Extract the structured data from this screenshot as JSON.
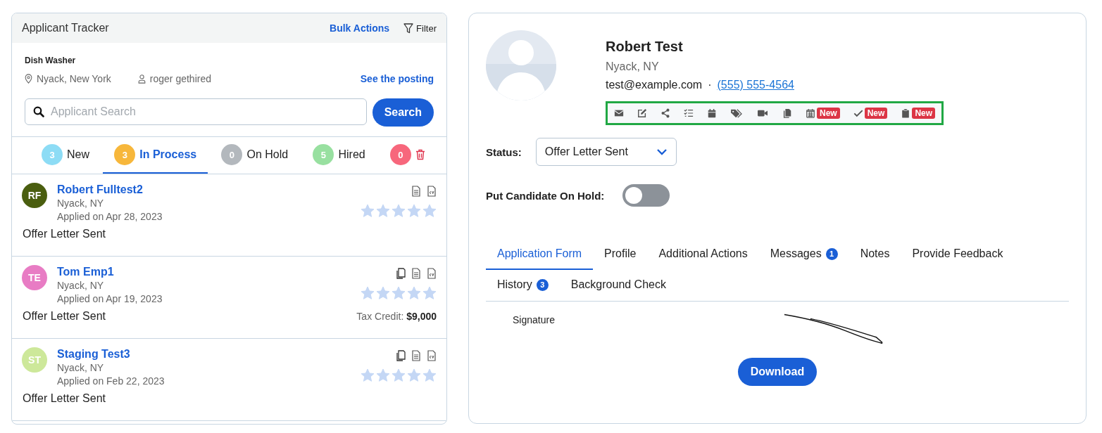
{
  "tracker": {
    "title": "Applicant Tracker",
    "bulk_actions": "Bulk Actions",
    "filter": "Filter",
    "job": {
      "title": "Dish Washer",
      "location": "Nyack, New York",
      "recruiter": "roger gethired",
      "posting_link": "See the posting"
    },
    "search": {
      "placeholder": "Applicant Search",
      "button": "Search"
    },
    "stages": [
      {
        "kind": "stage",
        "count": "3",
        "label": "New",
        "color": "#8ddcf5",
        "selected": false
      },
      {
        "kind": "stage",
        "count": "3",
        "label": "In Process",
        "color": "#f7b73b",
        "selected": true
      },
      {
        "kind": "stage",
        "count": "0",
        "label": "On Hold",
        "color": "#b3b8bd",
        "selected": false
      },
      {
        "kind": "stage",
        "count": "5",
        "label": "Hired",
        "color": "#98e0a0",
        "selected": false
      },
      {
        "kind": "trash",
        "count": "0",
        "color": "#f7677c",
        "selected": false
      }
    ],
    "applicants": [
      {
        "initials": "RF",
        "color": "#4a5e0f",
        "name": "Robert Fulltest2",
        "location": "Nyack, NY",
        "applied": "Applied on Apr 28, 2023",
        "status": "Offer Letter Sent",
        "files": [
          {
            "kind": "document"
          },
          {
            "kind": "cv"
          }
        ],
        "stars": 5
      },
      {
        "initials": "TE",
        "color": "#e87cc4",
        "name": "Tom Emp1",
        "location": "Nyack, NY",
        "applied": "Applied on Apr 19, 2023",
        "status": "Offer Letter Sent",
        "files": [
          {
            "kind": "copy"
          },
          {
            "kind": "document"
          },
          {
            "kind": "cv"
          }
        ],
        "stars": 5,
        "tax_credit_label": "Tax Credit:",
        "tax_credit": "$9,000"
      },
      {
        "initials": "ST",
        "color": "#cde89a",
        "name": "Staging Test3",
        "location": "Nyack, NY",
        "applied": "Applied on Feb 22, 2023",
        "status": "Offer Letter Sent",
        "files": [
          {
            "kind": "copy"
          },
          {
            "kind": "document"
          },
          {
            "kind": "cv"
          }
        ],
        "stars": 5
      }
    ]
  },
  "candidate": {
    "name": "Robert Test",
    "location": "Nyack, NY",
    "email": "test@example.com",
    "separator": "·",
    "phone": "(555) 555-4564",
    "actions": [
      {
        "kind": "mail"
      },
      {
        "kind": "edit"
      },
      {
        "kind": "share"
      },
      {
        "kind": "checklist"
      },
      {
        "kind": "calendar"
      },
      {
        "kind": "tags"
      },
      {
        "kind": "video"
      },
      {
        "kind": "copy"
      },
      {
        "kind": "grid-calendar",
        "badge": "New"
      },
      {
        "kind": "check",
        "badge": "New"
      },
      {
        "kind": "clipboard",
        "badge": "New"
      }
    ],
    "status_label": "Status:",
    "status_value": "Offer Letter Sent",
    "hold_label": "Put Candidate On Hold:",
    "hold_on": false,
    "tabs": [
      {
        "label": "Application Form",
        "selected": true
      },
      {
        "label": "Profile",
        "selected": false
      },
      {
        "label": "Additional Actions",
        "selected": false
      },
      {
        "label": "Messages",
        "badge": "1",
        "selected": false
      },
      {
        "label": "Notes",
        "selected": false
      },
      {
        "label": "Provide Feedback",
        "selected": false
      },
      {
        "label": "History",
        "badge": "3",
        "selected": false
      },
      {
        "label": "Background Check",
        "selected": false
      }
    ],
    "signature_label": "Signature",
    "download": "Download"
  }
}
